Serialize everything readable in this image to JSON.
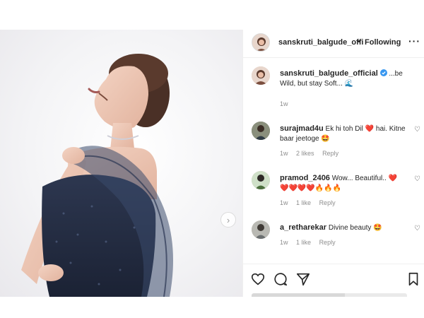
{
  "post": {
    "username_short": "sanskruti_balgude_offi",
    "dot": "•",
    "following_label": "Following",
    "more": "···"
  },
  "caption": {
    "username": "sanskruti_balgude_official",
    "verified_icon": "verified-badge-icon",
    "text": "...be Wild, but stay Soft...",
    "emoji": "🌊",
    "time": "1w"
  },
  "comments": [
    {
      "username": "surajmad4u",
      "text_a": "Ek hi toh Dil",
      "emoji_a": "❤️",
      "text_b": "hai. Kitne baar jeetoge",
      "emoji_b": "🤩",
      "time": "1w",
      "likes": "2 likes",
      "reply": "Reply"
    },
    {
      "username": "pramod_2406",
      "text_a": "Wow... Beautiful..",
      "emoji_a": "❤️",
      "emoji_b": "❤️❤️❤️❤️🔥🔥🔥",
      "time": "1w",
      "likes": "1 like",
      "reply": "Reply"
    },
    {
      "username": "a_retharekar",
      "text_a": "Divine beauty",
      "emoji_a": "🤩",
      "time": "1w",
      "likes": "1 like",
      "reply": "Reply"
    }
  ],
  "icons": {
    "like": "heart-outline-icon",
    "comment": "comment-icon",
    "share": "paper-plane-icon",
    "save": "bookmark-icon",
    "next": "chevron-right-icon"
  },
  "colors": {
    "verified": "#3897f0",
    "heart": "#ed4956",
    "text": "#262626",
    "muted": "#8e8e8e",
    "border": "#efefef"
  }
}
